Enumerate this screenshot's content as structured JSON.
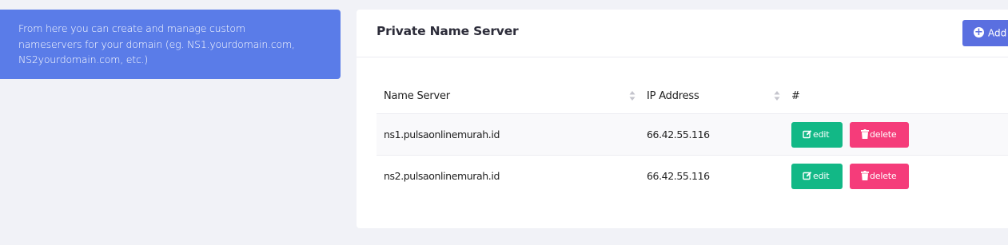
{
  "info": {
    "text": "From here you can create and manage custom nameservers for your domain (eg. NS1.yourdomain.com, NS2yourdomain.com, etc.)"
  },
  "panel": {
    "title": "Private Name Server",
    "add_label": "Add"
  },
  "table": {
    "headers": {
      "name_server": "Name Server",
      "ip_address": "IP Address",
      "actions": "#"
    },
    "rows": [
      {
        "name_server": "ns1.pulsaonlinemurah.id",
        "ip_address": "66.42.55.116",
        "edit_label": "edit",
        "delete_label": "delete"
      },
      {
        "name_server": "ns2.pulsaonlinemurah.id",
        "ip_address": "66.42.55.116",
        "edit_label": "edit",
        "delete_label": "delete"
      }
    ]
  },
  "colors": {
    "info_bg": "#5a7ce8",
    "add_button": "#5a6fe0",
    "edit_button": "#12b886",
    "delete_button": "#f53c7a"
  },
  "icons": {
    "add": "plus-circle-icon",
    "edit": "pencil-square-icon",
    "delete": "trash-icon",
    "sort": "sort-arrows-icon"
  }
}
